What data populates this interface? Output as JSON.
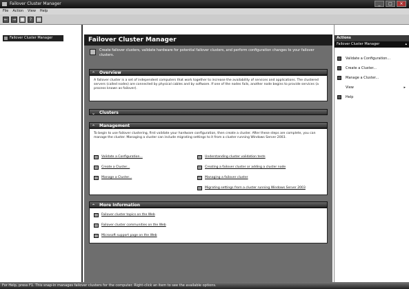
{
  "window": {
    "title": "Failover Cluster Manager",
    "controls": [
      "_",
      "□",
      "×"
    ]
  },
  "menu": [
    "File",
    "Action",
    "View",
    "Help"
  ],
  "toolbar": [
    "←",
    "→",
    "▦",
    "?",
    "▤"
  ],
  "tree": {
    "root": "Failover Cluster Manager"
  },
  "main": {
    "header": "Failover Cluster Manager",
    "intro": "Create failover clusters, validate hardware for potential failover clusters, and perform configuration changes to your failover clusters.",
    "sections": {
      "overview": {
        "title": "Overview",
        "text": "A failover cluster is a set of independent computers that work together to increase the availability of services and applications. The clustered servers (called nodes) are connected by physical cables and by software. If one of the nodes fails, another node begins to provide services (a process known as failover)."
      },
      "clusters": {
        "title": "Clusters"
      },
      "management": {
        "title": "Management",
        "text": "To begin to use failover clustering, first validate your hardware configuration, then create a cluster. After these steps are complete, you can manage the cluster. Managing a cluster can include migrating settings to it from a cluster running Windows Server 2003.",
        "left_links": [
          "Validate a Configuration...",
          "Create a Cluster...",
          "Manage a Cluster..."
        ],
        "right_links": [
          "Understanding cluster validation tests",
          "Creating a failover cluster or adding a cluster node",
          "Managing a failover cluster",
          "Migrating settings from a cluster running Windows Server 2003"
        ]
      },
      "more_info": {
        "title": "More Information",
        "links": [
          "Failover cluster topics on the Web",
          "Failover cluster communities on the Web",
          "Microsoft support page on the Web"
        ]
      }
    }
  },
  "actions": {
    "title": "Actions",
    "subtitle": "Failover Cluster Manager",
    "items": [
      "Validate a Configuration...",
      "Create a Cluster...",
      "Manage a Cluster...",
      "View",
      "Help"
    ]
  },
  "status": "For Help, press F1. This snap-in manages failover clusters for the computer. Right-click an item to see the available options."
}
